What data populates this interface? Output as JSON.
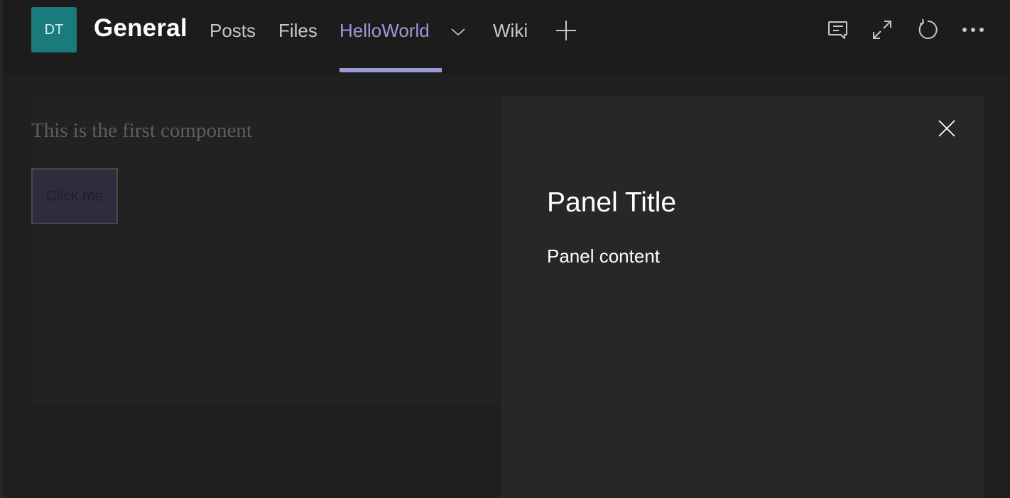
{
  "header": {
    "avatar_initials": "DT",
    "channel_name": "General",
    "tabs": [
      {
        "label": "Posts",
        "active": false
      },
      {
        "label": "Files",
        "active": false
      },
      {
        "label": "HelloWorld",
        "active": true,
        "has_dropdown": true
      },
      {
        "label": "Wiki",
        "active": false
      }
    ],
    "add_tab_icon": "plus-icon",
    "actions": [
      {
        "icon": "conversation-icon"
      },
      {
        "icon": "expand-icon"
      },
      {
        "icon": "refresh-icon"
      },
      {
        "icon": "more-options-icon"
      }
    ],
    "accent_color": "#9a9ad8",
    "avatar_color": "#1b7a7b"
  },
  "component": {
    "heading": "This is the first component",
    "button_label": "Click me"
  },
  "panel": {
    "title": "Panel Title",
    "content": "Panel content",
    "close_icon": "close-icon"
  }
}
